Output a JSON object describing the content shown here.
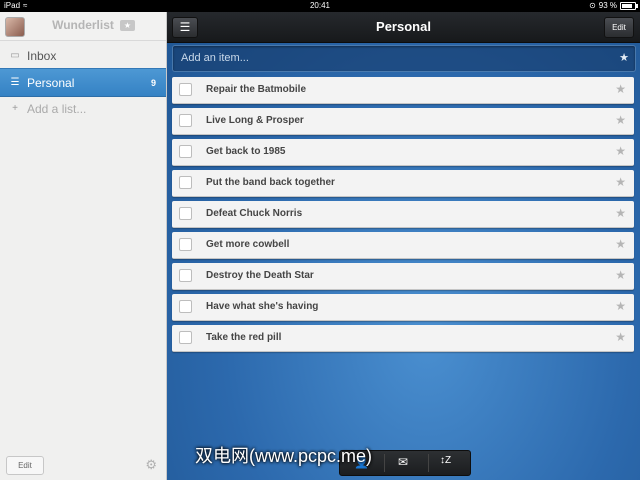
{
  "status_bar": {
    "device": "iPad",
    "time": "20:41",
    "battery": "93 %"
  },
  "sidebar": {
    "app_title": "Wunderlist",
    "items": [
      {
        "label": "Inbox",
        "icon": "inbox-icon",
        "count": ""
      },
      {
        "label": "Personal",
        "icon": "list-icon",
        "count": "9"
      }
    ],
    "add_list": "Add a list...",
    "edit_label": "Edit",
    "colors": {
      "active": "#3a8bcb"
    }
  },
  "main": {
    "title": "Personal",
    "edit_label": "Edit",
    "add_placeholder": "Add an item...",
    "tasks": [
      "Repair the Batmobile",
      "Live Long & Prosper",
      "Get back to 1985",
      "Put the band back together",
      "Defeat Chuck Norris",
      "Get more cowbell",
      "Destroy the Death Star",
      "Have what she's having",
      "Take the red pill"
    ]
  },
  "watermark": "双电网(www.pcpc.me)"
}
